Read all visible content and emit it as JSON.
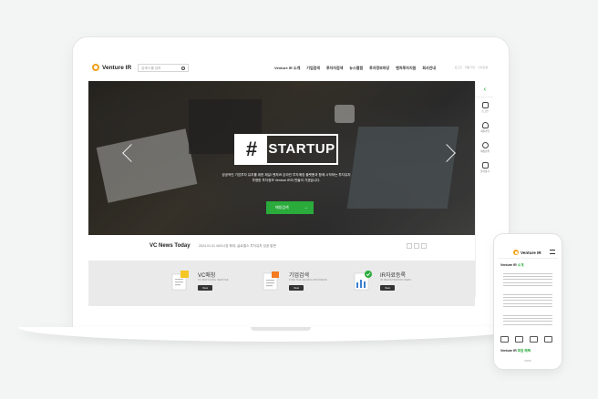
{
  "header": {
    "logo": "Venture IR",
    "search_placeholder": "검색어 를 입력",
    "nav": [
      "Venture IR 소개",
      "기업검색",
      "투자자검색",
      "뉴스컬럼",
      "투자정보마당",
      "벤처투자지원",
      "회사안내"
    ],
    "util": [
      "로그인",
      "회원가입",
      "사이트맵"
    ]
  },
  "hero": {
    "badge_hash": "#",
    "badge_text": "STARTUP",
    "desc_1": "성공적인 기업투자 유치를 위한 채널! 벤처IR 온라인 투자매칭 플랫폼과 함께 시작하는 투자유치",
    "desc_2": "투명한 투자정보 Venture IR이 만들어 가겠습니다.",
    "button": "매칭검색",
    "button_arrow": "→"
  },
  "rail": {
    "items": [
      {
        "label": "로그인",
        "icon": "lock-icon"
      },
      {
        "label": "회원가입",
        "icon": "person-icon"
      },
      {
        "label": "매칭검색",
        "icon": "magnifier-icon"
      },
      {
        "label": "즐겨찾기",
        "icon": "bookmark-icon"
      }
    ]
  },
  "news": {
    "title": "VC News Today",
    "text": "2024.01.01  VAS시장 확대, 글로벌스 투자유치 성공 발판"
  },
  "features": [
    {
      "title": "VC매칭",
      "sub": "VC MATCHING SERVICE",
      "button": "View"
    },
    {
      "title": "기업검색",
      "sub": "FIND THE SEARCH BUSINESS",
      "button": "View"
    },
    {
      "title": "IR자료등록",
      "sub": "IR REGISTRATION SERV.",
      "button": "View"
    }
  ],
  "phone": {
    "logo": "Venture IR",
    "section_title_a": "Venture IR ",
    "section_title_b": "소개",
    "footer_title_a": "Venture IR ",
    "footer_title_b": "회원 혜택"
  },
  "colors": {
    "accent": "#2aab3c",
    "logo": "#f2a21d"
  }
}
